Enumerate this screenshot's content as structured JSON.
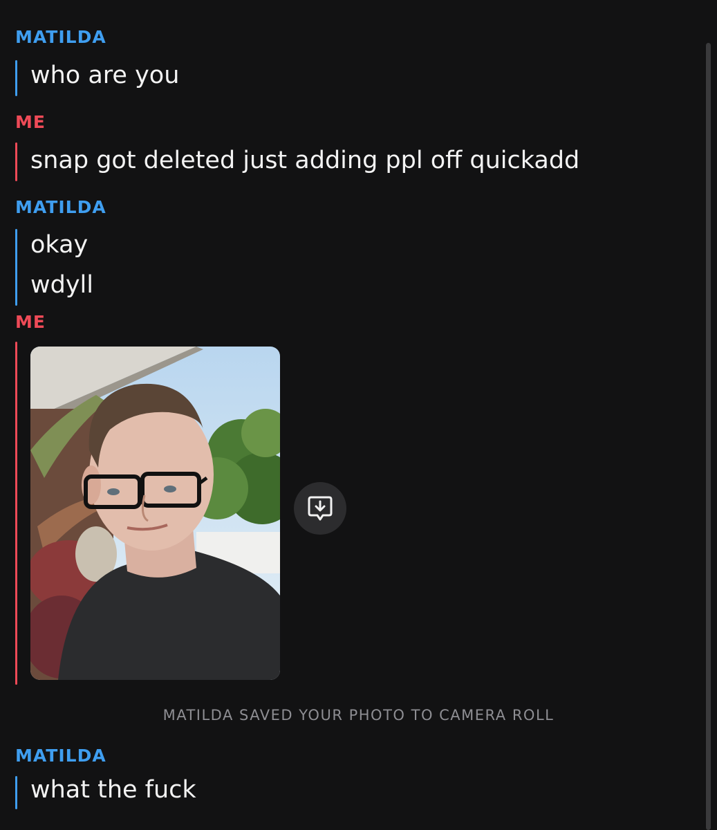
{
  "conversation": [
    {
      "sender": "MATILDA",
      "lines": [
        "who are you"
      ]
    },
    {
      "sender": "ME",
      "lines": [
        "snap got deleted just adding ppl off quickadd"
      ]
    },
    {
      "sender": "MATILDA",
      "lines": [
        "okay",
        "wdyll"
      ]
    },
    {
      "sender": "ME",
      "attachment": "photo"
    },
    {
      "sender": "MATILDA",
      "lines": [
        "what the fuck"
      ]
    }
  ],
  "system_notice": "MATILDA SAVED YOUR PHOTO TO CAMERA ROLL",
  "icons": {
    "save_button": "download-to-chat-icon"
  },
  "colors": {
    "background": "#121213",
    "them_accent": "#3f9ef0",
    "me_accent": "#ee4a57",
    "message_text": "#f3f3f3",
    "system_text": "#8e8e93"
  }
}
